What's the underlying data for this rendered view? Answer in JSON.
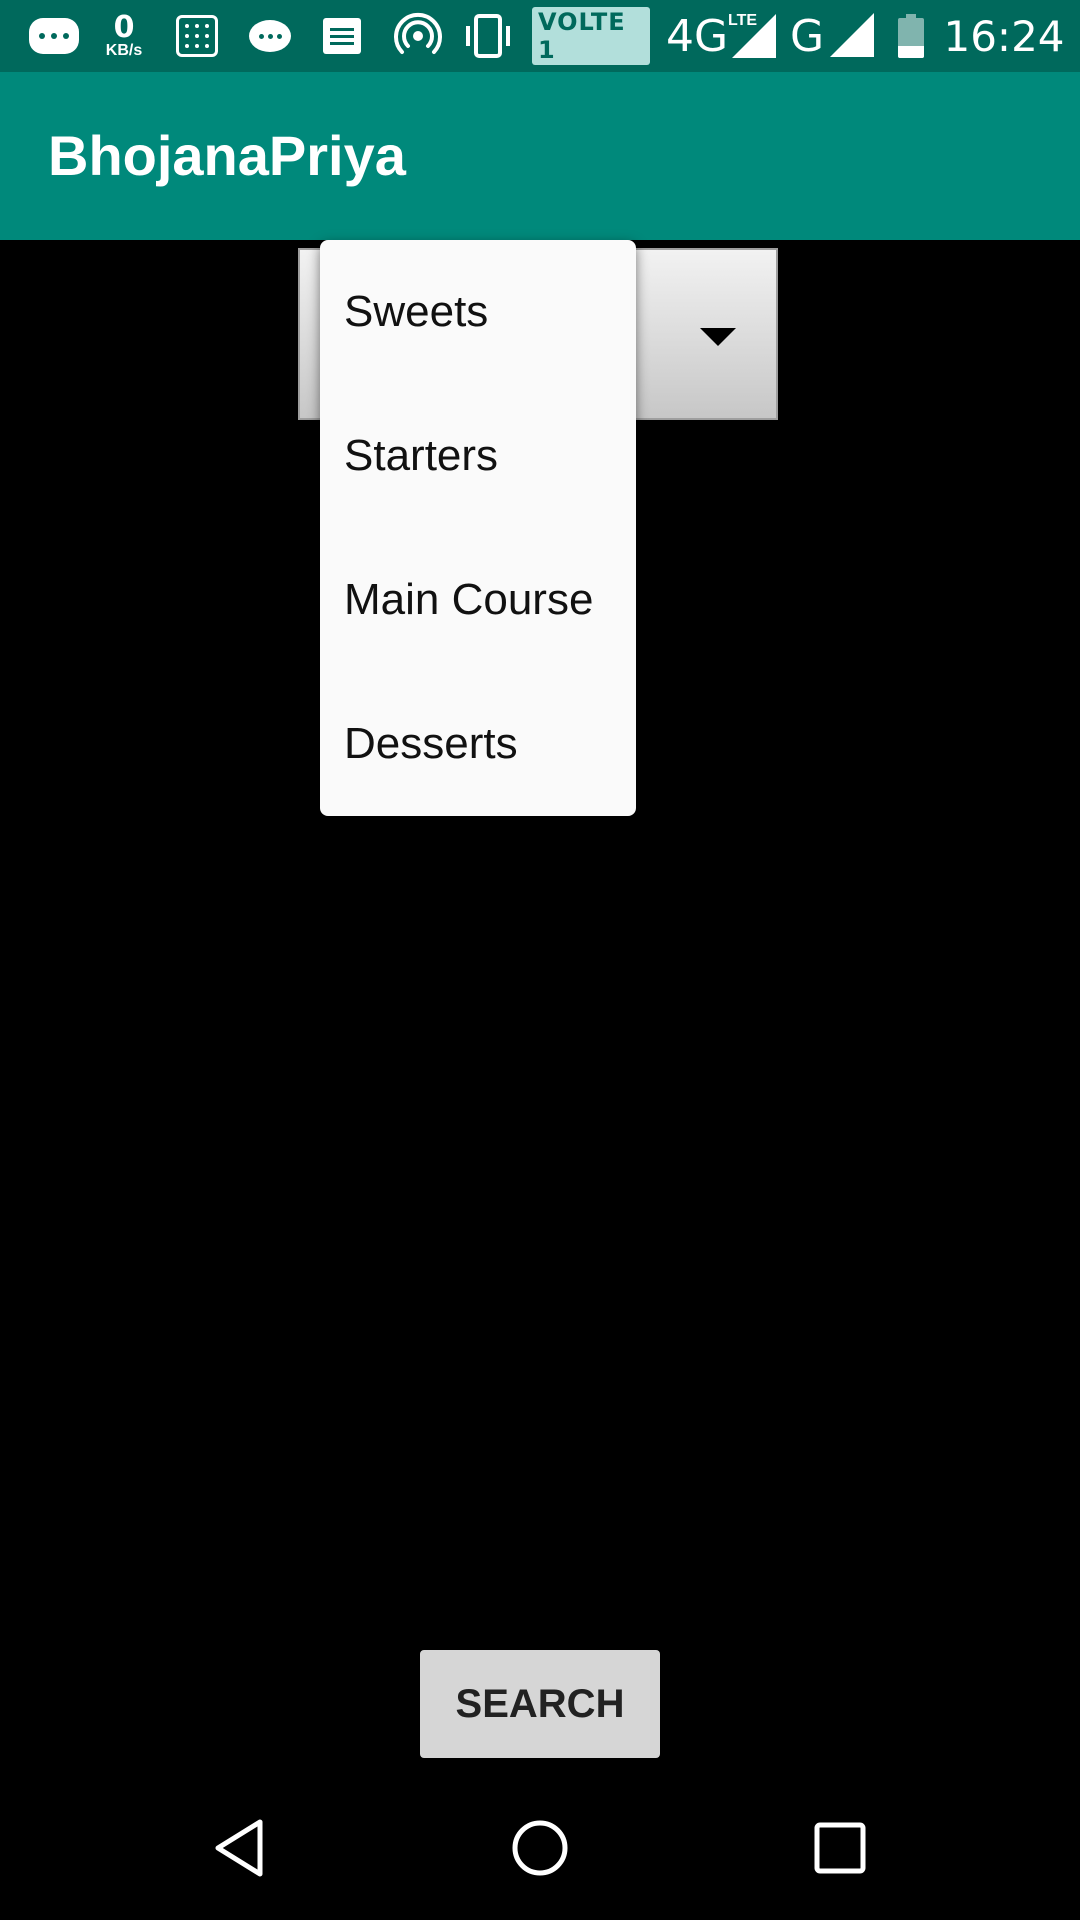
{
  "status_bar": {
    "data_speed_value": "0",
    "data_speed_unit": "KB/s",
    "volte_label": "VOLTE 1",
    "network_4g": "4G",
    "network_lte": "LTE",
    "network_g": "G",
    "time": "16:24",
    "icons": [
      "message-bubble-icon",
      "calculator-icon",
      "chat-icon",
      "document-icon",
      "hotspot-icon",
      "vibrate-icon",
      "signal-icon",
      "battery-icon"
    ]
  },
  "app_bar": {
    "title": "BhojanaPriya",
    "color": "#00897b"
  },
  "dropdown": {
    "options": [
      "Sweets",
      "Starters",
      "Main Course",
      "Desserts"
    ]
  },
  "search_button": {
    "label": "SEARCH"
  },
  "nav_bar": {
    "icons": [
      "back-icon",
      "home-icon",
      "recents-icon"
    ]
  }
}
